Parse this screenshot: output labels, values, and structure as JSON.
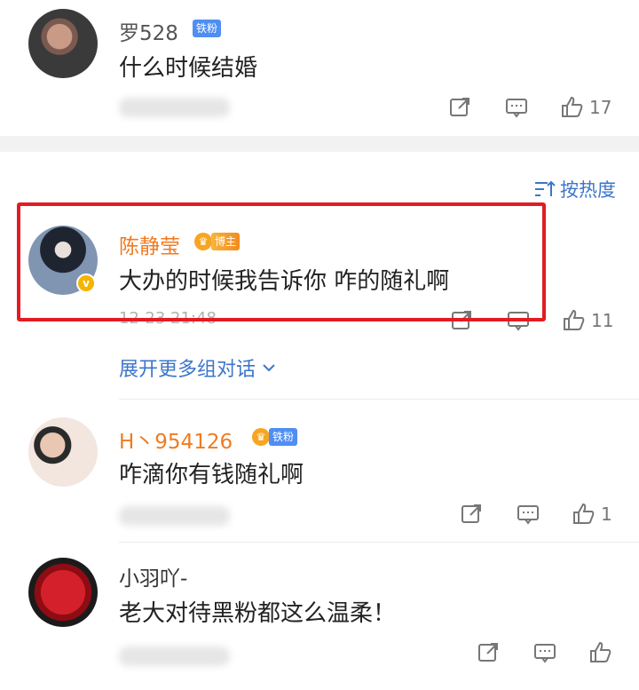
{
  "sort": {
    "label": "按热度",
    "icon": "sort-icon"
  },
  "comments": [
    {
      "user": "罗528",
      "badge": "铁粉",
      "text": "什么时候结婚",
      "likes": "17"
    },
    {
      "user": "陈静莹",
      "badge": "博主",
      "text": "大办的时候我告诉你 咋的随礼啊",
      "time": "12-23 21:48",
      "likes": "11",
      "expand": "展开更多组对话"
    },
    {
      "user": "H丶954126",
      "badge": "铁粉",
      "text": "咋滴你有钱随礼啊",
      "likes": "1"
    },
    {
      "user": "小羽吖-",
      "text": "老大对待黑粉都这么温柔！",
      "likes": ""
    }
  ],
  "colors": {
    "link_blue": "#3d76c9",
    "highlight_red": "#e31b23",
    "orange_name": "#f07b21"
  }
}
